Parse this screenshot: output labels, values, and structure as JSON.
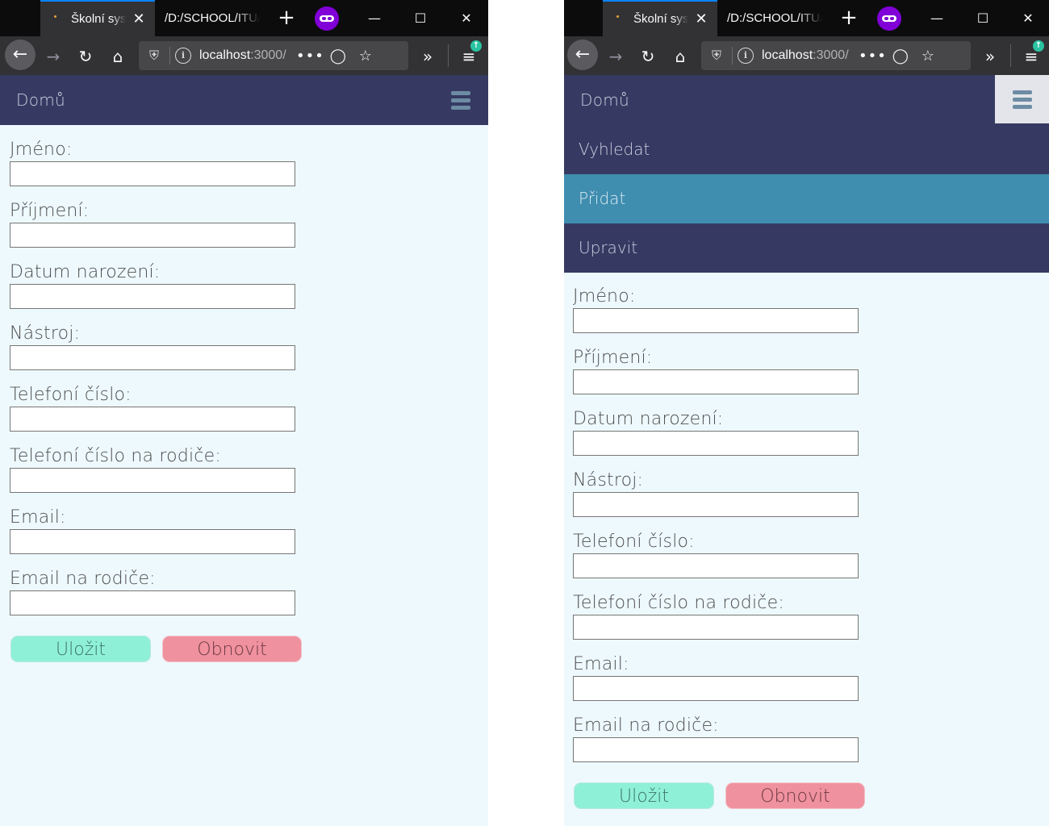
{
  "browser": {
    "active_tab_title": "Školní syst",
    "inactive_tab_title": "/D:/SCHOOL/ITU/",
    "url_host": "localhost",
    "url_port": ":3000/",
    "new_tab_glyph": "+",
    "close_tab_glyph": "✕",
    "window_controls": {
      "minimize": "—",
      "maximize": "☐",
      "close": "✕"
    },
    "icons": [
      "back-arrow-icon",
      "forward-arrow-icon",
      "reload-icon",
      "home-icon",
      "shield-icon",
      "info-icon",
      "more-icon",
      "pocket-icon",
      "bookmark-star-icon",
      "overflow-chevrons-icon",
      "hamburger-menu-icon",
      "private-mask-icon"
    ]
  },
  "app": {
    "brand": "Domů",
    "menu": [
      {
        "label": "Vyhledat",
        "active": false
      },
      {
        "label": "Přidat",
        "active": true
      },
      {
        "label": "Upravit",
        "active": false
      }
    ],
    "colors": {
      "header": "#363a62",
      "menu_active": "#3f8daf",
      "page_bg": "#eef9fd",
      "save_button": "#8ff0d8",
      "reset_button": "#f0919f"
    }
  },
  "form": {
    "fields": [
      {
        "label": "Jméno:",
        "value": ""
      },
      {
        "label": "Příjmení:",
        "value": ""
      },
      {
        "label": "Datum narození:",
        "value": ""
      },
      {
        "label": "Nástroj:",
        "value": ""
      },
      {
        "label": "Telefoní číslo:",
        "value": ""
      },
      {
        "label": "Telefoní číslo na rodiče:",
        "value": ""
      },
      {
        "label": "Email:",
        "value": ""
      },
      {
        "label": "Email na rodiče:",
        "value": ""
      }
    ],
    "save_label": "Uložit",
    "reset_label": "Obnovit"
  }
}
